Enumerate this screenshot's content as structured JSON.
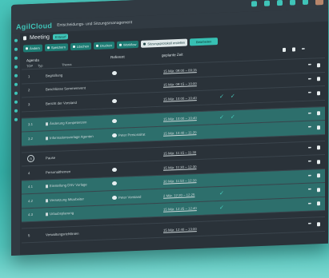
{
  "app": {
    "logo": "AgilCloud",
    "subtitle": "Entscheidungs- und Sitzungsmanagement"
  },
  "meeting": {
    "title": "Meeting",
    "status_badge": "Entwurf"
  },
  "toolbar": {
    "buttons": [
      "Ändern",
      "Speichern",
      "Löschen",
      "Drucken",
      "Workflow",
      "Sitzungsprotokoll erstellen",
      "Bearbeiten"
    ]
  },
  "table": {
    "headers": {
      "agenda": "Agenda",
      "thema": "Thema",
      "person": "Referent",
      "time": "geplante Zeit"
    },
    "subheaders": {
      "top": "TOP",
      "typ": "Typ"
    },
    "rows": [
      {
        "num": "1",
        "thema": "Begrüßung",
        "person_icon": true,
        "person": "",
        "time": "15 Mär. 09:00 – 09:15",
        "check1": false,
        "check2": false,
        "teal": false
      },
      {
        "num": "2",
        "thema": "Beschlüsse Sommerevent",
        "person_icon": false,
        "person": "",
        "time": "15 Mär. 09:15 – 10:00",
        "check1": false,
        "check2": false,
        "teal": false
      },
      {
        "num": "3",
        "thema": "Bericht der Vorstand",
        "person_icon": true,
        "person": "",
        "time": "15 Mär. 10:00 – 10:40",
        "check1": true,
        "check2": true,
        "teal": false
      },
      {
        "num": "3.1",
        "thema": "Änderung Kompetenzen",
        "person_icon": true,
        "person": "",
        "time": "15 Mär. 10:00 – 10:40",
        "check1": true,
        "check2": true,
        "teal": true
      },
      {
        "num": "3.2",
        "thema": "Informationsvorlage Agenten",
        "person_icon": true,
        "person": "Peter Personalrat",
        "time": "15 Mär. 10:40 – 11:20",
        "check1": false,
        "check2": false,
        "teal": true
      },
      {
        "num": "",
        "thema": "Pause",
        "person_icon": false,
        "person": "",
        "time": "15 Mär. 11:15 – 11:30",
        "check1": false,
        "check2": false,
        "teal": false
      },
      {
        "num": "4",
        "thema": "Personalthemen",
        "person_icon": true,
        "person": "",
        "time": "15 Mär. 11:30 – 12:30",
        "check1": false,
        "check2": false,
        "teal": false
      },
      {
        "num": "4.1",
        "thema": "Einstellung DSV Vorlage",
        "person_icon": true,
        "person": "",
        "time": "30 Mär. 11:50 – 12:10",
        "check1": false,
        "check2": false,
        "teal": true
      },
      {
        "num": "4.2",
        "thema": "Versetzung Mitarbeiter",
        "person_icon": true,
        "person": "Peter Vorstand",
        "time": "2 Mär. 12:20 – 12:25",
        "check1": true,
        "check2": false,
        "teal": true
      },
      {
        "num": "4.3",
        "thema": "Urlaubsplanung",
        "person_icon": false,
        "person": "",
        "time": "15 Mär. 12:25 – 12:40",
        "check1": true,
        "check2": false,
        "teal": true
      },
      {
        "num": "5",
        "thema": "Verwaltungsrichtlinien",
        "person_icon": false,
        "person": "",
        "time": "15 Mär. 12:40 – 13:00",
        "check1": false,
        "check2": false,
        "teal": false
      }
    ]
  },
  "colors": {
    "accent": "#3fc4b8",
    "background": "#49c6bc",
    "panel": "#2a3239",
    "row_highlight": "#2d6f6c"
  }
}
